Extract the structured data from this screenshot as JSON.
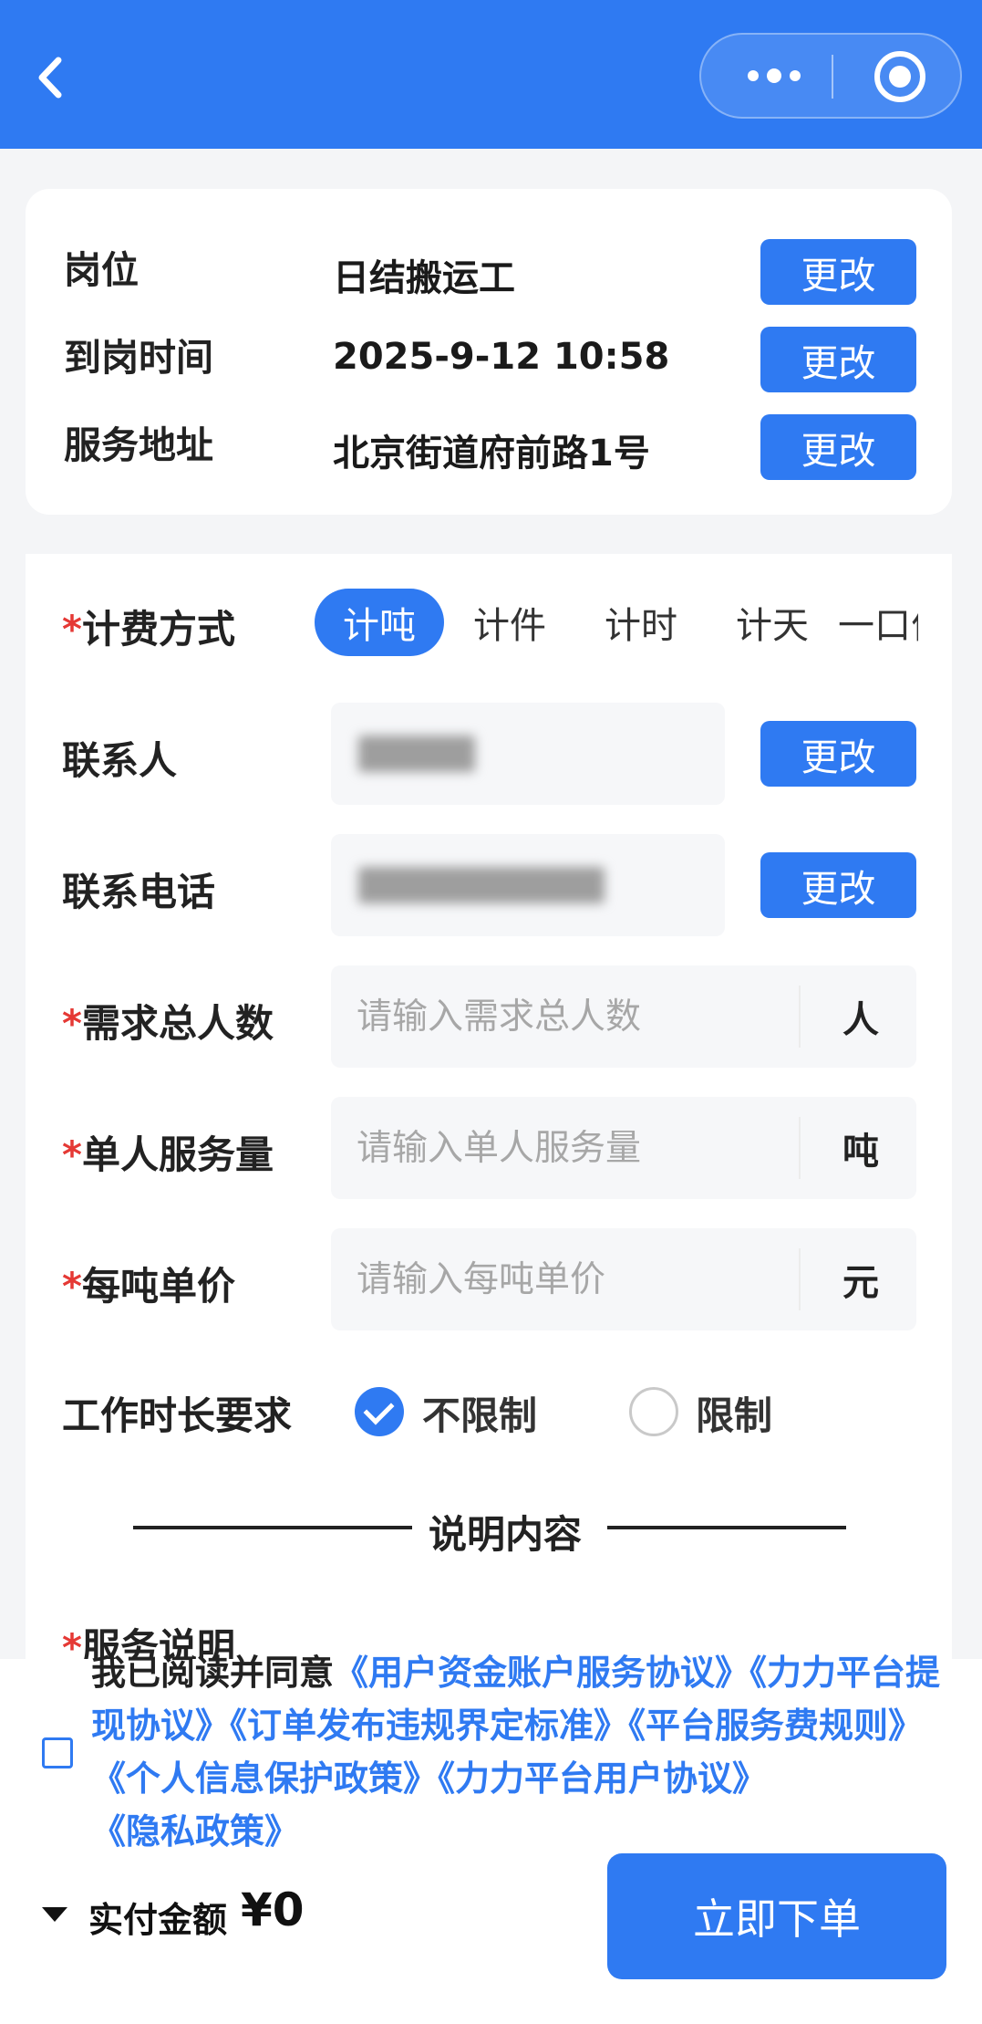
{
  "header": {
    "back_icon": "chevron-left-icon",
    "more_icon": "more-dots-icon",
    "target_icon": "record-circle-icon",
    "bar_color": "#2f7af2"
  },
  "summary": {
    "rows": [
      {
        "label": "岗位",
        "value": "日结搬运工",
        "button": "更改"
      },
      {
        "label": "到岗时间",
        "value": "2025-9-12 10:58",
        "button": "更改"
      },
      {
        "label": "服务地址",
        "value": "北京街道府前路1号",
        "button": "更改"
      }
    ]
  },
  "form": {
    "required_mark": "*",
    "billing": {
      "label": "计费方式",
      "tabs": [
        "计吨",
        "计件",
        "计时",
        "计天",
        "一口价"
      ],
      "selected": "计吨"
    },
    "contact": {
      "label": "联系人",
      "value_redacted": true,
      "button": "更改"
    },
    "phone": {
      "label": "联系电话",
      "value_redacted": true,
      "button": "更改"
    },
    "headcount": {
      "label": "需求总人数",
      "placeholder": "请输入需求总人数",
      "unit": "人",
      "value": ""
    },
    "per_person": {
      "label": "单人服务量",
      "placeholder": "请输入单人服务量",
      "unit": "吨",
      "value": ""
    },
    "unit_price": {
      "label": "每吨单价",
      "placeholder": "请输入每吨单价",
      "unit": "元",
      "value": ""
    },
    "work_duration": {
      "label": "工作时长要求",
      "options": [
        "不限制",
        "限制"
      ],
      "selected": "不限制"
    },
    "section_title": "说明内容",
    "service_desc_label": "服务说明"
  },
  "agreement": {
    "prefix": "我已阅读并同意",
    "links": [
      "《用户资金账户服务协议》",
      "《力力平台提现协议》",
      "《订单发布违规界定标准》",
      "《平台服务费规则》",
      "《个人信息保护政策》",
      "《力力平台用户协议》",
      "《隐私政策》"
    ],
    "checked": false
  },
  "footer": {
    "pay_label": "实付金额",
    "amount": "¥0",
    "submit": "立即下单"
  },
  "colors": {
    "accent": "#2f7af2",
    "required": "#e53935"
  }
}
